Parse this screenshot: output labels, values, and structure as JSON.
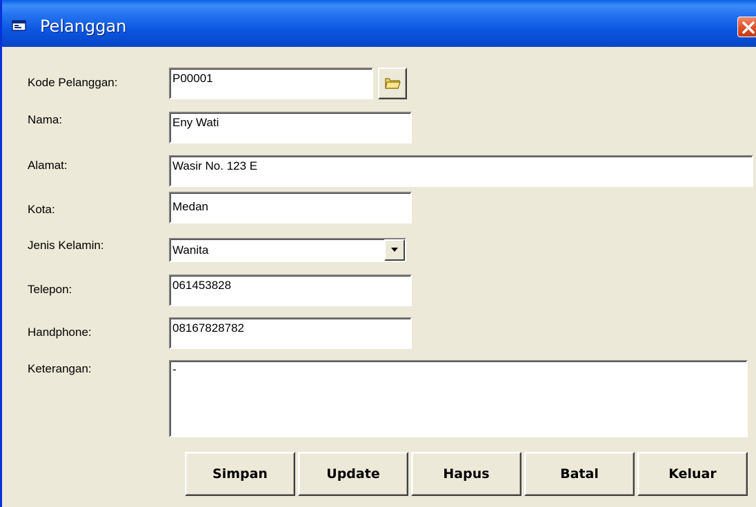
{
  "window": {
    "title": "Pelanggan"
  },
  "form": {
    "kode_label": "Kode Pelanggan:",
    "kode_value": "P00001",
    "nama_label": "Nama:",
    "nama_value": "Eny Wati",
    "alamat_label": "Alamat:",
    "alamat_value": "Wasir No. 123 E",
    "kota_label": "Kota:",
    "kota_value": "Medan",
    "jenis_kelamin_label": "Jenis Kelamin:",
    "jenis_kelamin_value": "Wanita",
    "telepon_label": "Telepon:",
    "telepon_value": "061453828",
    "handphone_label": "Handphone:",
    "handphone_value": "08167828782",
    "keterangan_label": "Keterangan:",
    "keterangan_value": "-"
  },
  "buttons": {
    "simpan": "Simpan",
    "update": "Update",
    "hapus": "Hapus",
    "batal": "Batal",
    "keluar": "Keluar"
  },
  "icons": {
    "title": "form-icon",
    "close": "close-icon",
    "browse": "folder-icon",
    "dropdown": "chevron-down-icon"
  },
  "colors": {
    "titlebar": "#0a56e0",
    "close": "#e0542c",
    "window_bg": "#ece9d8"
  }
}
